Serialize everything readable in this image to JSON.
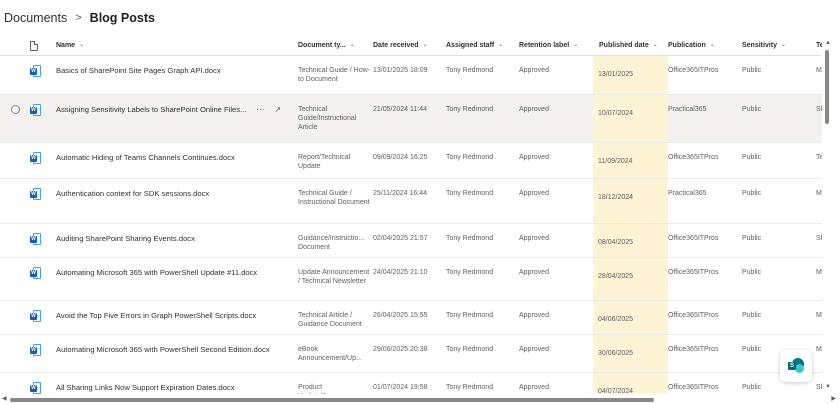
{
  "breadcrumb": {
    "root": "Documents",
    "separator": ">",
    "current": "Blog Posts"
  },
  "columns": {
    "name": "Name",
    "type": "Document ty...",
    "date_received": "Date received",
    "staff": "Assigned staff",
    "retention": "Retention label",
    "published": "Published date",
    "publication": "Publication",
    "sensitivity": "Sensitivity",
    "te": "Te"
  },
  "rows": [
    {
      "name": "Basics of SharePoint Site Pages Graph API.docx",
      "type": "Technical Guide / How-to Document",
      "received": "13/01/2025 18:09",
      "staff": "Tony Redmond",
      "retention": "Approved",
      "published": "13/01/2025",
      "publication": "Office365ITPros",
      "sensitivity": "Public",
      "te": "Mic"
    },
    {
      "name": "Assigning Sensitivity Labels to SharePoint Online Files...",
      "type": "Technical Guide/Instructional Article",
      "received": "21/05/2024 11:44",
      "staff": "Tony Redmond",
      "retention": "Approved",
      "published": "10/07/2024",
      "publication": "Practical365",
      "sensitivity": "Public",
      "te": "Sha"
    },
    {
      "name": "Automatic Hiding of Teams Channels Continues.docx",
      "type": "Report/Technical Update",
      "received": "09/09/2024 16:25",
      "staff": "Tony Redmond",
      "retention": "Approved",
      "published": "11/09/2024",
      "publication": "Office365ITPros",
      "sensitivity": "Public",
      "te": "Tea"
    },
    {
      "name": "Authentication context for SDK sessions.docx",
      "type": "Technical Guide / Instructional Document",
      "received": "25/11/2024 16:44",
      "staff": "Tony Redmond",
      "retention": "Approved",
      "published": "18/12/2024",
      "publication": "Practical365",
      "sensitivity": "Public",
      "te": "Mic"
    },
    {
      "name": "Auditing SharePoint Sharing Events.docx",
      "type": "Guidance/Instructio... Document",
      "received": "02/04/2025 21:57",
      "staff": "Tony Redmond",
      "retention": "Approved",
      "published": "08/04/2025",
      "publication": "Office365ITPros",
      "sensitivity": "Public",
      "te": "Sha"
    },
    {
      "name": "Automating Microsoft 365 with PowerShell Update #11.docx",
      "type": "Update Announcement / Technical Newsletter",
      "received": "24/04/2025 21:10",
      "staff": "Tony Redmond",
      "retention": "Approved",
      "published": "28/04/2025",
      "publication": "Office365ITPros",
      "sensitivity": "Public",
      "te": "Mic"
    },
    {
      "name": "Avoid the Top Five Errors in Graph PowerShell Scripts.docx",
      "type": "Technical Article / Guidance Document",
      "received": "26/04/2025 15:55",
      "staff": "Tony Redmond",
      "retention": "Approved",
      "published": "04/06/2025",
      "publication": "Office365ITPros",
      "sensitivity": "Public",
      "te": "Mic"
    },
    {
      "name": "Automating Microsoft 365 with PowerShell Second Edition.docx",
      "type": "eBook Announcement/Up...",
      "received": "29/06/2025 20:38",
      "staff": "Tony Redmond",
      "retention": "Approved",
      "published": "30/06/2025",
      "publication": "Office365ITPros",
      "sensitivity": "Public",
      "te": "Mic"
    },
    {
      "name": "All Sharing Links Now Support Expiration Dates.docx",
      "type": "Product Update/Announce...",
      "received": "01/07/2024 19:58",
      "staff": "Tony Redmond",
      "retention": "Approved",
      "published": "04/07/2024",
      "publication": "Office365ITPros",
      "sensitivity": "Public",
      "te": "Sha"
    }
  ],
  "icons": {
    "file": "word-doc-icon",
    "header": "document-icon",
    "fab": "sharepoint-logo-icon"
  },
  "colors": {
    "published_highlight": "#fdf3d5",
    "selected_row": "#f3f2f1",
    "word_blue": "#185abd",
    "sharepoint_teal": "#03787c"
  }
}
